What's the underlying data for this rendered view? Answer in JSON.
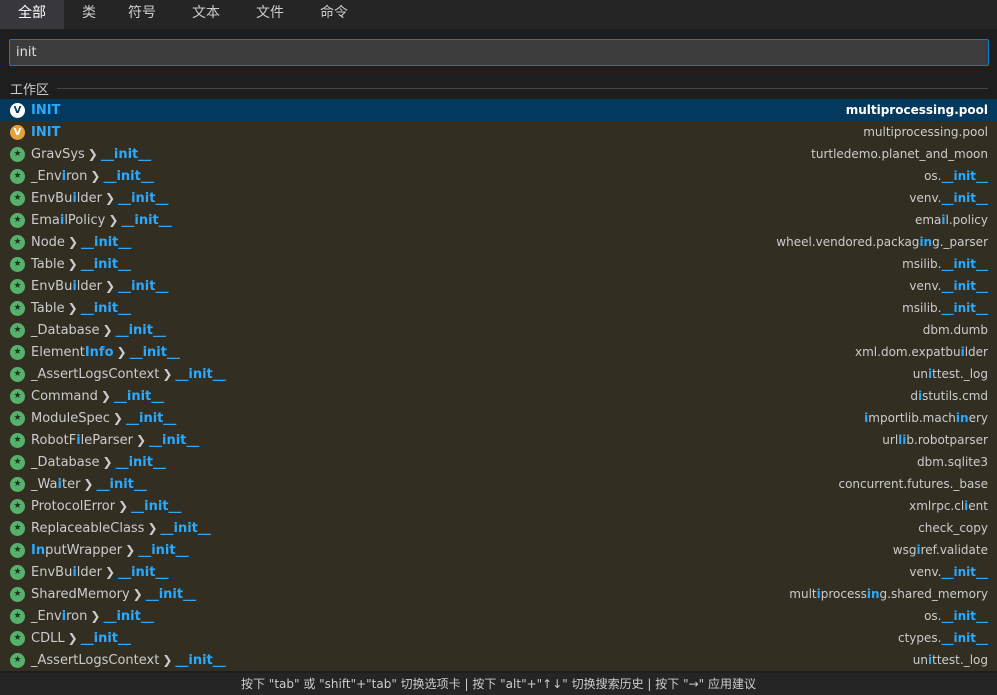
{
  "tabs": [
    {
      "label": "全部",
      "active": true
    },
    {
      "label": "类",
      "active": false
    },
    {
      "label": "符号",
      "active": false
    },
    {
      "label": "文本",
      "active": false
    },
    {
      "label": "文件",
      "active": false
    },
    {
      "label": "命令",
      "active": false
    }
  ],
  "search": {
    "value": "init",
    "placeholder": ""
  },
  "section": {
    "label": "工作区"
  },
  "results": [
    {
      "icon": "var-sel",
      "name": [
        [
          "INIT",
          true
        ]
      ],
      "member": null,
      "location": [
        [
          "multiprocessing.pool",
          false
        ]
      ],
      "selected": true
    },
    {
      "icon": "var",
      "name": [
        [
          "INIT",
          true
        ]
      ],
      "member": null,
      "location": [
        [
          "multiprocessing.pool",
          false
        ]
      ],
      "selected": false
    },
    {
      "icon": "star",
      "name": [
        [
          "GravSys",
          false
        ]
      ],
      "member": "__init__",
      "location": [
        [
          "turtledemo.planet_and_moon",
          false
        ]
      ]
    },
    {
      "icon": "star",
      "name": [
        [
          "_Env",
          false
        ],
        [
          "i",
          true
        ],
        [
          "ron",
          false
        ]
      ],
      "member": "__init__",
      "location": [
        [
          "os.",
          false
        ],
        [
          "__init__",
          true
        ]
      ]
    },
    {
      "icon": "star",
      "name": [
        [
          "EnvBu",
          false
        ],
        [
          "i",
          true
        ],
        [
          "lder",
          false
        ]
      ],
      "member": "__init__",
      "location": [
        [
          "venv.",
          false
        ],
        [
          "__init__",
          true
        ]
      ]
    },
    {
      "icon": "star",
      "name": [
        [
          "Ema",
          false
        ],
        [
          "i",
          true
        ],
        [
          "lPolicy",
          false
        ]
      ],
      "member": "__init__",
      "location": [
        [
          "ema",
          false
        ],
        [
          "i",
          true
        ],
        [
          "l.policy",
          false
        ]
      ]
    },
    {
      "icon": "star",
      "name": [
        [
          "Node",
          false
        ]
      ],
      "member": "__init__",
      "location": [
        [
          "wheel.vendored.packag",
          false
        ],
        [
          "in",
          true
        ],
        [
          "g._parser",
          false
        ]
      ]
    },
    {
      "icon": "star",
      "name": [
        [
          "Table",
          false
        ]
      ],
      "member": "__init__",
      "location": [
        [
          "msilib.",
          false
        ],
        [
          "__init__",
          true
        ]
      ]
    },
    {
      "icon": "star",
      "name": [
        [
          "EnvBu",
          false
        ],
        [
          "i",
          true
        ],
        [
          "lder",
          false
        ]
      ],
      "member": "__init__",
      "location": [
        [
          "venv.",
          false
        ],
        [
          "__init__",
          true
        ]
      ]
    },
    {
      "icon": "star",
      "name": [
        [
          "Table",
          false
        ]
      ],
      "member": "__init__",
      "location": [
        [
          "msilib.",
          false
        ],
        [
          "__init__",
          true
        ]
      ]
    },
    {
      "icon": "star",
      "name": [
        [
          "_Database",
          false
        ]
      ],
      "member": "__init__",
      "location": [
        [
          "dbm.dumb",
          false
        ]
      ]
    },
    {
      "icon": "star",
      "name": [
        [
          "Element",
          false
        ],
        [
          "Info",
          true
        ]
      ],
      "member": "__init__",
      "location": [
        [
          "xml.dom.expatbu",
          false
        ],
        [
          "i",
          true
        ],
        [
          "lder",
          false
        ]
      ]
    },
    {
      "icon": "star",
      "name": [
        [
          "_AssertLogsContext",
          false
        ]
      ],
      "member": "__init__",
      "location": [
        [
          "un",
          false
        ],
        [
          "i",
          true
        ],
        [
          "ttest._log",
          false
        ]
      ]
    },
    {
      "icon": "star",
      "name": [
        [
          "Command",
          false
        ]
      ],
      "member": "__init__",
      "location": [
        [
          "d",
          false
        ],
        [
          "i",
          true
        ],
        [
          "stutils.cmd",
          false
        ]
      ]
    },
    {
      "icon": "star",
      "name": [
        [
          "ModuleSpec",
          false
        ]
      ],
      "member": "__init__",
      "location": [
        [
          "i",
          true
        ],
        [
          "mportlib.mach",
          false
        ],
        [
          "in",
          true
        ],
        [
          "ery",
          false
        ]
      ]
    },
    {
      "icon": "star",
      "name": [
        [
          "RobotF",
          false
        ],
        [
          "i",
          true
        ],
        [
          "leParser",
          false
        ]
      ],
      "member": "__init__",
      "location": [
        [
          "url",
          false
        ],
        [
          "li",
          true
        ],
        [
          "b.robotparser",
          false
        ]
      ]
    },
    {
      "icon": "star",
      "name": [
        [
          "_Database",
          false
        ]
      ],
      "member": "__init__",
      "location": [
        [
          "dbm.sqlite3",
          false
        ]
      ]
    },
    {
      "icon": "star",
      "name": [
        [
          "_Wa",
          false
        ],
        [
          "i",
          true
        ],
        [
          "ter",
          false
        ]
      ],
      "member": "__init__",
      "location": [
        [
          "concurrent.futures._base",
          false
        ]
      ]
    },
    {
      "icon": "star",
      "name": [
        [
          "ProtocolError",
          false
        ]
      ],
      "member": "__init__",
      "location": [
        [
          "xmlrpc.cl",
          false
        ],
        [
          "i",
          true
        ],
        [
          "ent",
          false
        ]
      ]
    },
    {
      "icon": "star",
      "name": [
        [
          "ReplaceableClass",
          false
        ]
      ],
      "member": "__init__",
      "location": [
        [
          "check_copy",
          false
        ]
      ]
    },
    {
      "icon": "star",
      "name": [
        [
          "In",
          true
        ],
        [
          "putWrapper",
          false
        ]
      ],
      "member": "__init__",
      "location": [
        [
          "wsg",
          false
        ],
        [
          "i",
          true
        ],
        [
          "ref.validate",
          false
        ]
      ]
    },
    {
      "icon": "star",
      "name": [
        [
          "EnvBu",
          false
        ],
        [
          "i",
          true
        ],
        [
          "lder",
          false
        ]
      ],
      "member": "__init__",
      "location": [
        [
          "venv.",
          false
        ],
        [
          "__init__",
          true
        ]
      ]
    },
    {
      "icon": "star",
      "name": [
        [
          "SharedMemory",
          false
        ]
      ],
      "member": "__init__",
      "location": [
        [
          "mult",
          false
        ],
        [
          "i",
          true
        ],
        [
          "process",
          false
        ],
        [
          "in",
          true
        ],
        [
          "g.shared_memory",
          false
        ]
      ]
    },
    {
      "icon": "star",
      "name": [
        [
          "_Env",
          false
        ],
        [
          "i",
          true
        ],
        [
          "ron",
          false
        ]
      ],
      "member": "__init__",
      "location": [
        [
          "os.",
          false
        ],
        [
          "__init__",
          true
        ]
      ]
    },
    {
      "icon": "star",
      "name": [
        [
          "CDLL",
          false
        ]
      ],
      "member": "__init__",
      "location": [
        [
          "ctypes.",
          false
        ],
        [
          "__init__",
          true
        ]
      ]
    },
    {
      "icon": "star",
      "name": [
        [
          "_AssertLogsContext",
          false
        ]
      ],
      "member": "__init__",
      "location": [
        [
          "un",
          false
        ],
        [
          "i",
          true
        ],
        [
          "ttest._log",
          false
        ]
      ]
    }
  ],
  "footer": {
    "hint": "按下 \"tab\" 或 \"shift\"+\"tab\" 切换选项卡 | 按下 \"alt\"+\"↑↓\" 切换搜索历史 | 按下 \"→\" 应用建议"
  },
  "colors": {
    "accent": "#2aaaff",
    "selected_row": "#04395e",
    "results_bg": "#322e22",
    "var_icon": "#e2a33a",
    "class_icon": "#56b26b"
  }
}
